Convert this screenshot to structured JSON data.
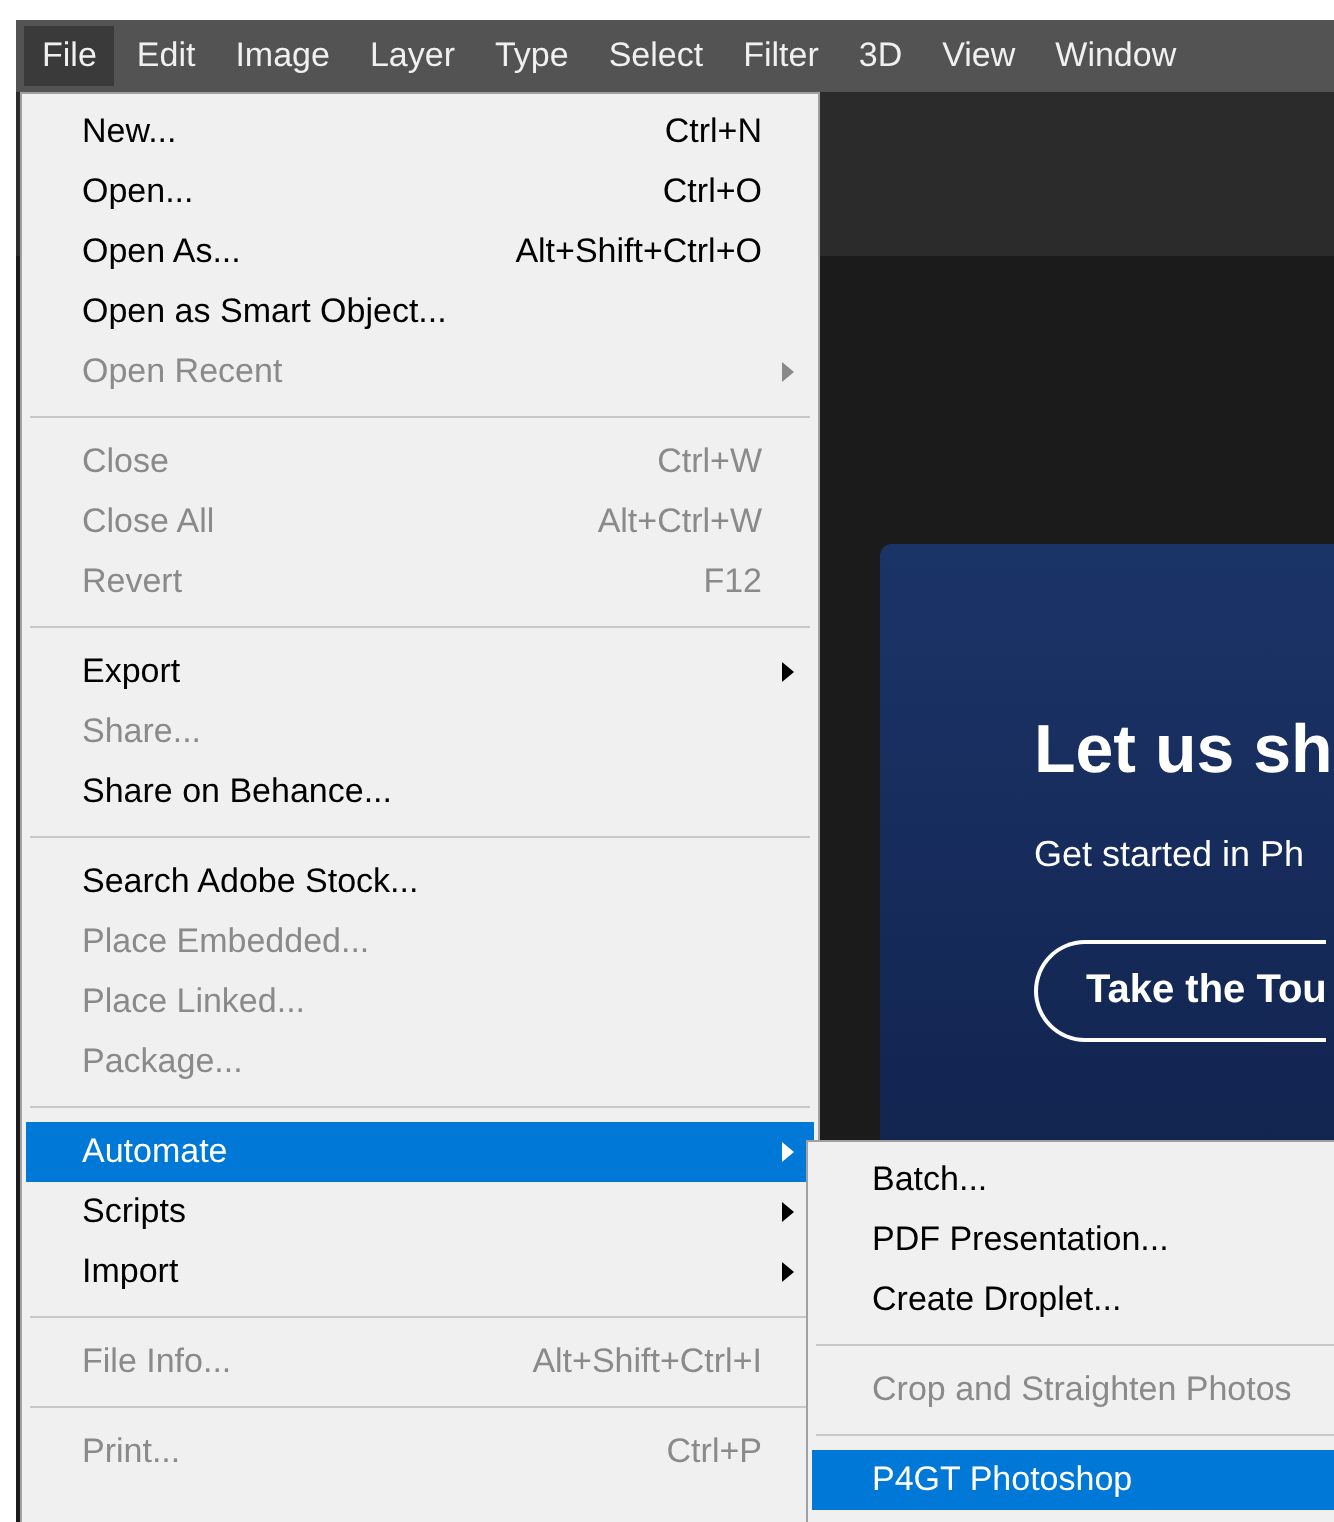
{
  "menubar": [
    {
      "label": "File",
      "selected": true
    },
    {
      "label": "Edit",
      "selected": false
    },
    {
      "label": "Image",
      "selected": false
    },
    {
      "label": "Layer",
      "selected": false
    },
    {
      "label": "Type",
      "selected": false
    },
    {
      "label": "Select",
      "selected": false
    },
    {
      "label": "Filter",
      "selected": false
    },
    {
      "label": "3D",
      "selected": false
    },
    {
      "label": "View",
      "selected": false
    },
    {
      "label": "Window",
      "selected": false
    }
  ],
  "file_menu": {
    "groups": [
      [
        {
          "label": "New...",
          "shortcut": "Ctrl+N",
          "disabled": false,
          "submenu": false,
          "selected": false
        },
        {
          "label": "Open...",
          "shortcut": "Ctrl+O",
          "disabled": false,
          "submenu": false,
          "selected": false
        },
        {
          "label": "Open As...",
          "shortcut": "Alt+Shift+Ctrl+O",
          "disabled": false,
          "submenu": false,
          "selected": false
        },
        {
          "label": "Open as Smart Object...",
          "disabled": false,
          "submenu": false,
          "selected": false
        },
        {
          "label": "Open Recent",
          "disabled": true,
          "submenu": true,
          "selected": false
        }
      ],
      [
        {
          "label": "Close",
          "shortcut": "Ctrl+W",
          "disabled": true,
          "submenu": false,
          "selected": false
        },
        {
          "label": "Close All",
          "shortcut": "Alt+Ctrl+W",
          "disabled": true,
          "submenu": false,
          "selected": false
        },
        {
          "label": "Revert",
          "shortcut": "F12",
          "disabled": true,
          "submenu": false,
          "selected": false
        }
      ],
      [
        {
          "label": "Export",
          "disabled": false,
          "submenu": true,
          "selected": false
        },
        {
          "label": "Share...",
          "disabled": true,
          "submenu": false,
          "selected": false
        },
        {
          "label": "Share on Behance...",
          "disabled": false,
          "submenu": false,
          "selected": false
        }
      ],
      [
        {
          "label": "Search Adobe Stock...",
          "disabled": false,
          "submenu": false,
          "selected": false
        },
        {
          "label": "Place Embedded...",
          "disabled": true,
          "submenu": false,
          "selected": false
        },
        {
          "label": "Place Linked...",
          "disabled": true,
          "submenu": false,
          "selected": false
        },
        {
          "label": "Package...",
          "disabled": true,
          "submenu": false,
          "selected": false
        }
      ],
      [
        {
          "label": "Automate",
          "disabled": false,
          "submenu": true,
          "selected": true
        },
        {
          "label": "Scripts",
          "disabled": false,
          "submenu": true,
          "selected": false
        },
        {
          "label": "Import",
          "disabled": false,
          "submenu": true,
          "selected": false
        }
      ],
      [
        {
          "label": "File Info...",
          "shortcut": "Alt+Shift+Ctrl+I",
          "disabled": true,
          "submenu": false,
          "selected": false
        }
      ],
      [
        {
          "label": "Print...",
          "shortcut": "Ctrl+P",
          "disabled": true,
          "submenu": false,
          "selected": false
        }
      ]
    ]
  },
  "automate_submenu": {
    "groups": [
      [
        {
          "label": "Batch...",
          "disabled": false,
          "selected": false
        },
        {
          "label": "PDF Presentation...",
          "disabled": false,
          "selected": false
        },
        {
          "label": "Create Droplet...",
          "disabled": false,
          "selected": false
        }
      ],
      [
        {
          "label": "Crop and Straighten Photos",
          "disabled": true,
          "selected": false
        }
      ],
      [
        {
          "label": "P4GT Photoshop",
          "disabled": false,
          "selected": true
        }
      ]
    ]
  },
  "welcome_card": {
    "title": "Let us sh",
    "subtitle": "Get started in Ph",
    "button": "Take the Tou"
  }
}
